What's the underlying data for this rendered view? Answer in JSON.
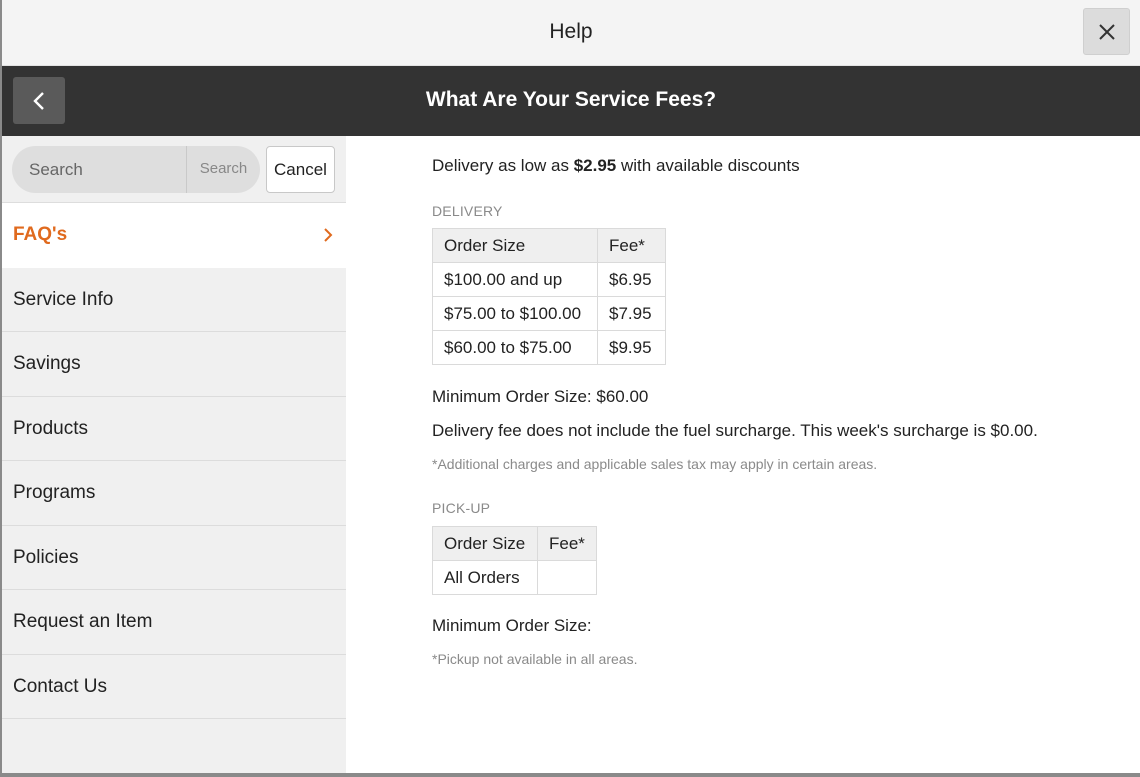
{
  "window": {
    "title": "Help",
    "close_icon": "close-icon"
  },
  "header": {
    "back_icon": "chevron-left-icon",
    "title": "What Are Your Service Fees?"
  },
  "search": {
    "placeholder": "Search",
    "button_label": "Search",
    "cancel_label": "Cancel"
  },
  "sidebar": {
    "accent_color": "#e06a1e",
    "items": [
      {
        "label": "FAQ's",
        "active": true
      },
      {
        "label": "Service Info"
      },
      {
        "label": "Savings"
      },
      {
        "label": "Products"
      },
      {
        "label": "Programs"
      },
      {
        "label": "Policies"
      },
      {
        "label": "Request an Item"
      },
      {
        "label": "Contact Us"
      }
    ]
  },
  "content": {
    "lead_prefix": "Delivery as low as ",
    "lead_amount": "$2.95",
    "lead_suffix": " with available discounts",
    "delivery": {
      "label": "DELIVERY",
      "headers": [
        "Order Size",
        "Fee*"
      ],
      "rows": [
        [
          "$100.00 and up",
          "$6.95"
        ],
        [
          "$75.00 to $100.00",
          "$7.95"
        ],
        [
          "$60.00 to $75.00",
          "$9.95"
        ]
      ],
      "minimum": "Minimum Order Size: $60.00",
      "surcharge": "Delivery fee does not include the fuel surcharge. This week's surcharge is $0.00.",
      "note": "*Additional charges and applicable sales tax may apply in certain areas."
    },
    "pickup": {
      "label": "PICK-UP",
      "headers": [
        "Order Size",
        "Fee*"
      ],
      "rows": [
        [
          "All Orders",
          ""
        ]
      ],
      "minimum": "Minimum Order Size:",
      "note": "*Pickup not available in all areas."
    }
  }
}
